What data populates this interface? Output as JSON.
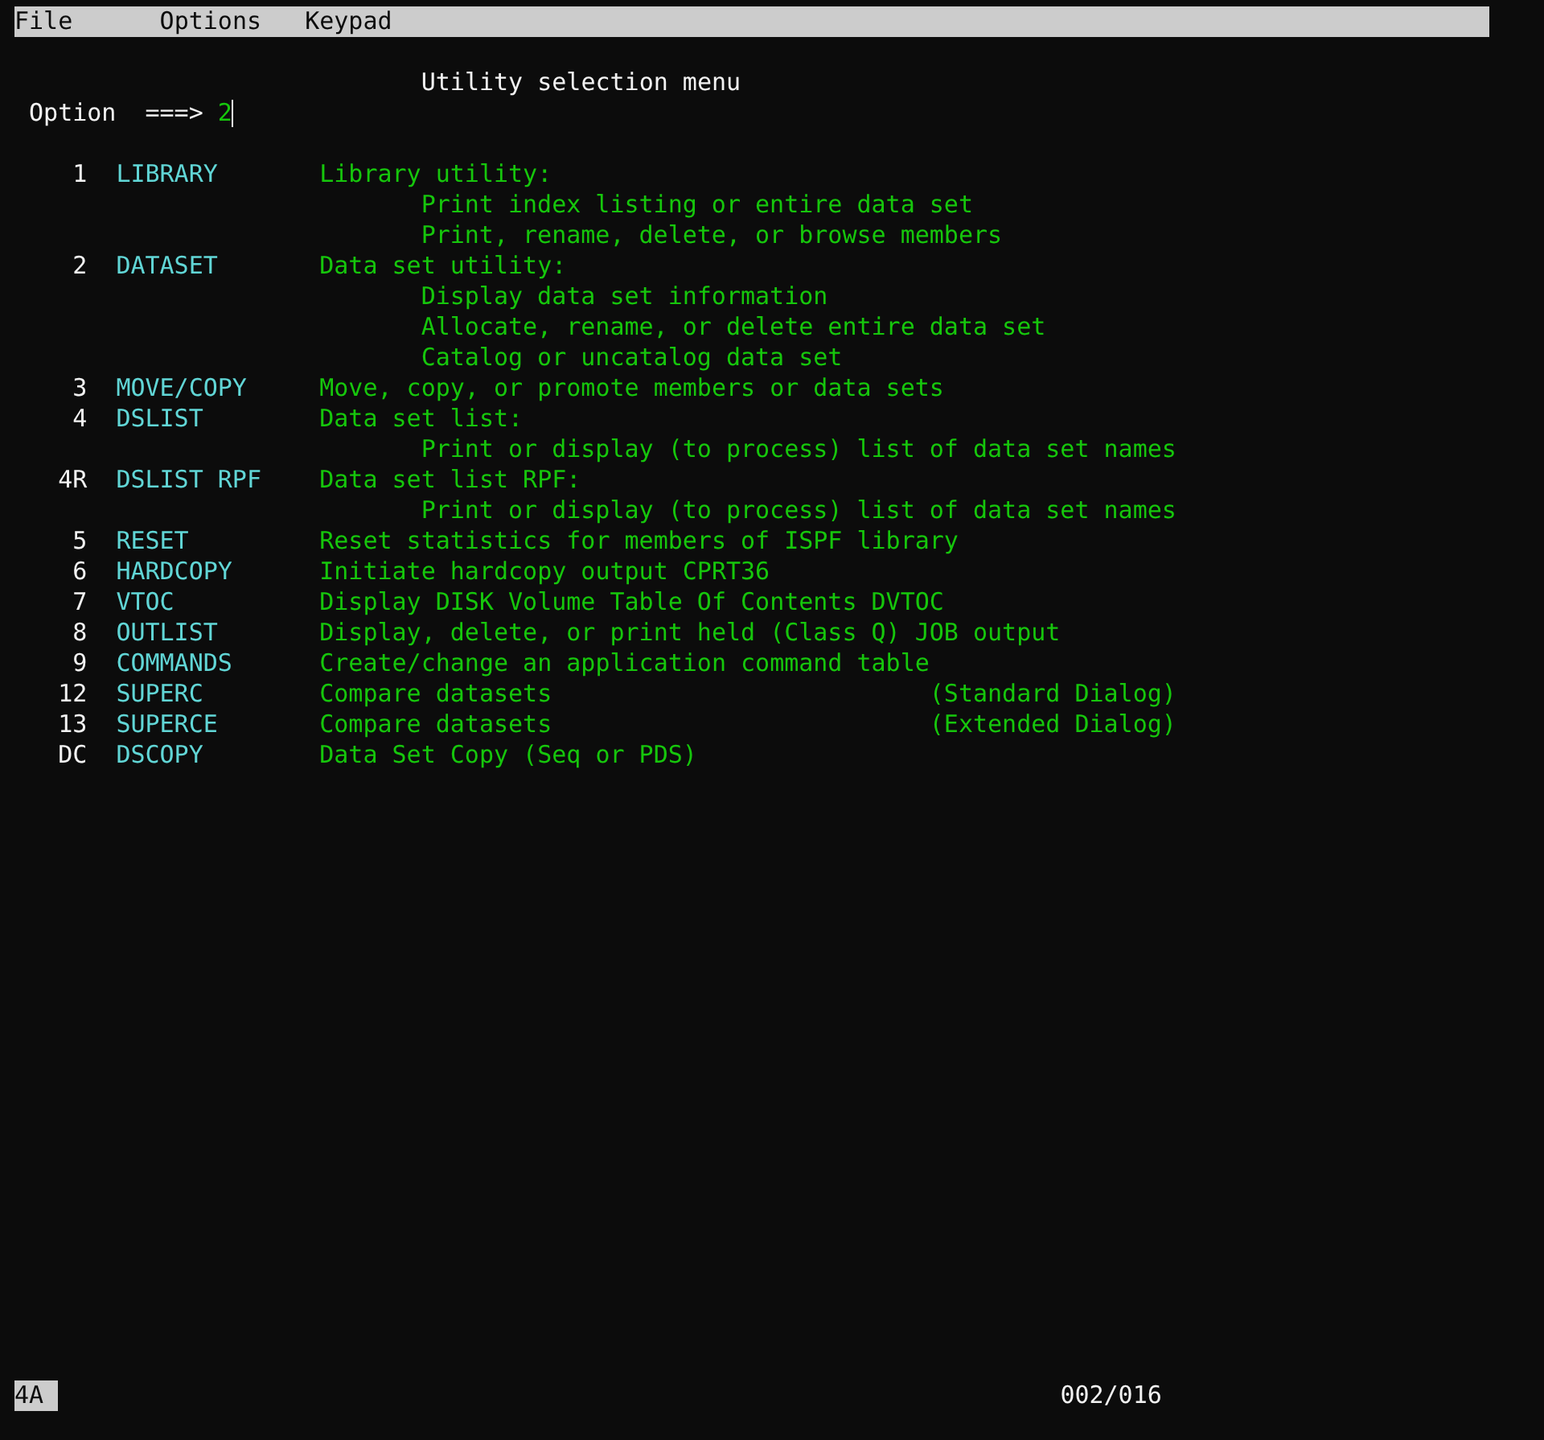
{
  "menu_bar": [
    "File",
    "Options",
    "Keypad"
  ],
  "title": "Utility selection menu",
  "option": {
    "label": "Option",
    "arrow": "===>",
    "value": "2"
  },
  "items": [
    {
      "number": "1",
      "name": "LIBRARY",
      "description": "Library utility:",
      "details": [
        "Print index listing or entire data set",
        "Print, rename, delete, or browse members"
      ]
    },
    {
      "number": "2",
      "name": "DATASET",
      "description": "Data set utility:",
      "details": [
        "Display data set information",
        "Allocate, rename, or delete entire data set",
        "Catalog or uncatalog data set"
      ]
    },
    {
      "number": "3",
      "name": "MOVE/COPY",
      "description": "Move, copy, or promote members or data sets"
    },
    {
      "number": "4",
      "name": "DSLIST",
      "description": "Data set list:",
      "details": [
        "Print or display (to process) list of data set names"
      ]
    },
    {
      "number": "4R",
      "name": "DSLIST RPF",
      "description": "Data set list RPF:",
      "details": [
        "Print or display (to process) list of data set names"
      ]
    },
    {
      "number": "5",
      "name": "RESET",
      "description": "Reset statistics for members of ISPF library"
    },
    {
      "number": "6",
      "name": "HARDCOPY",
      "description": "Initiate hardcopy output CPRT36"
    },
    {
      "number": "7",
      "name": "VTOC",
      "description": "Display DISK Volume Table Of Contents DVTOC"
    },
    {
      "number": "8",
      "name": "OUTLIST",
      "description": "Display, delete, or print held (Class Q) JOB output"
    },
    {
      "number": "9",
      "name": "COMMANDS",
      "description": "Create/change an application command table"
    },
    {
      "number": "12",
      "name": "SUPERC",
      "description": "Compare datasets",
      "note": "(Standard Dialog)"
    },
    {
      "number": "13",
      "name": "SUPERCE",
      "description": "Compare datasets",
      "note": "(Extended Dialog)"
    },
    {
      "number": "DC",
      "name": "DSCOPY",
      "description": "Data Set Copy (Seq or PDS)"
    }
  ],
  "status_bar": {
    "indicator": "4A",
    "position": "002/016"
  }
}
